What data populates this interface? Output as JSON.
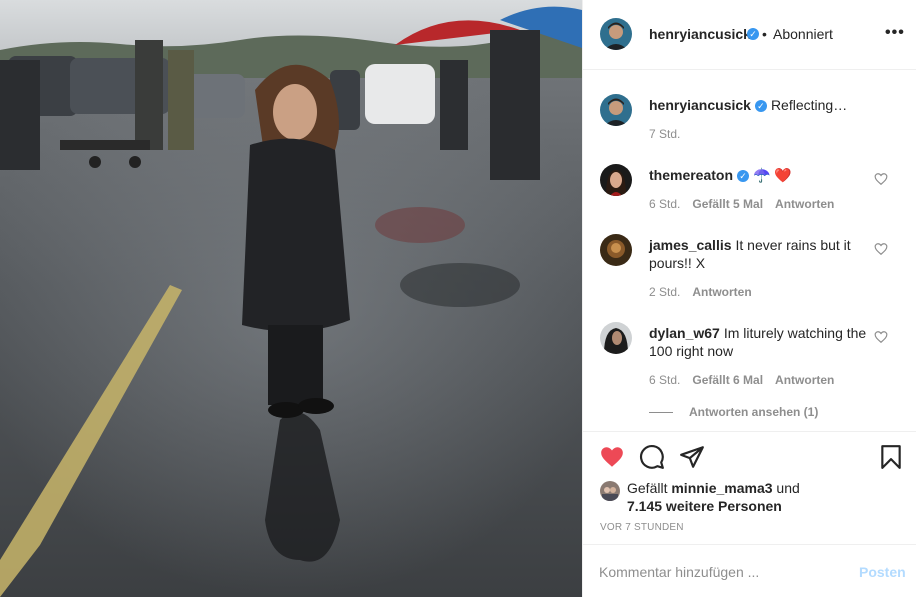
{
  "post": {
    "author": "henryiancusick",
    "follow_status": "Abonniert",
    "dot": "•",
    "more_icon": "more-horizontal-icon",
    "caption": "Reflecting…",
    "caption_time": "7 Std."
  },
  "comments": [
    {
      "username": "themereaton",
      "text": "☂️ ❤️",
      "time": "6 Std.",
      "likes": "Gefällt 5 Mal",
      "reply": "Antworten",
      "verified": true
    },
    {
      "username": "james_callis",
      "text": "It never rains but it pours!! X",
      "time": "2 Std.",
      "likes": "",
      "reply": "Antworten",
      "verified": false
    },
    {
      "username": "dylan_w67",
      "text": "Im liturely watching the 100 right now",
      "time": "6 Std.",
      "likes": "Gefällt 6 Mal",
      "reply": "Antworten",
      "verified": false
    }
  ],
  "view_replies": "Antworten ansehen (1)",
  "likes": {
    "prefix": "Gefällt",
    "user": "minnie_mama3",
    "conjunction": "und",
    "others": "7.145 weitere Personen"
  },
  "time_ago": "VOR 7 STUNDEN",
  "comment_box": {
    "placeholder": "Kommentar hinzufügen ...",
    "post_label": "Posten"
  },
  "colors": {
    "liked_heart": "#ed4956",
    "verified": "#3897f0",
    "post_disabled": "#b3dbff"
  },
  "icons": [
    "heart-filled-icon",
    "comment-icon",
    "share-icon",
    "bookmark-icon",
    "heart-outline-icon",
    "verified-icon"
  ]
}
